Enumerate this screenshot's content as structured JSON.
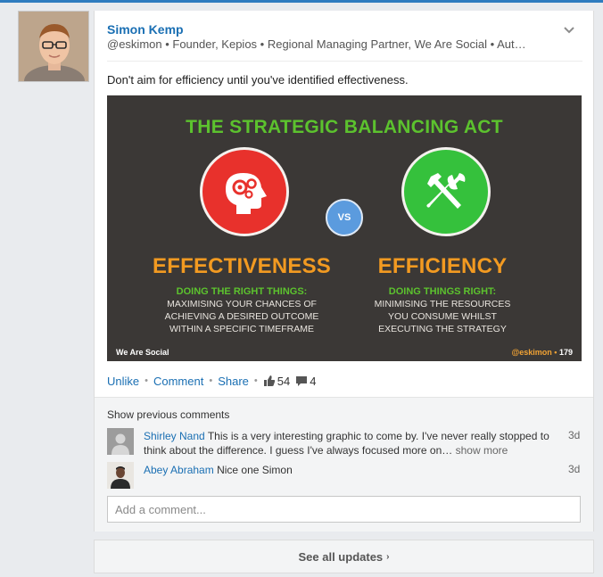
{
  "post": {
    "author_name": "Simon Kemp",
    "author_headline": "@eskimon • Founder, Kepios • Regional Managing Partner, We Are Social • Aut…",
    "text": "Don't aim for efficiency until you've identified effectiveness."
  },
  "slide": {
    "title": "THE STRATEGIC BALANCING ACT",
    "vs": "VS",
    "left_word": "EFFECTIVENESS",
    "left_sub": "DOING THE RIGHT THINGS:",
    "left_lines": [
      "MAXIMISING YOUR CHANCES OF",
      "ACHIEVING A DESIRED OUTCOME",
      "WITHIN A SPECIFIC TIMEFRAME"
    ],
    "right_word": "EFFICIENCY",
    "right_sub": "DOING THINGS RIGHT:",
    "right_lines": [
      "MINIMISING THE RESOURCES",
      "YOU CONSUME WHILST",
      "EXECUTING THE STRATEGY"
    ],
    "brand": "We Are Social",
    "handle": "@eskimon",
    "dot": "•",
    "page_number": "179",
    "colors": {
      "title_green": "#5cc22e",
      "orange": "#f29a21",
      "red_circle": "#e8312c",
      "green_circle": "#35c13c",
      "vs_blue": "#5b9bde"
    }
  },
  "actions": {
    "unlike": "Unlike",
    "comment": "Comment",
    "share": "Share",
    "separator": "•",
    "likes": "54",
    "comments": "4"
  },
  "comments": {
    "show_previous": "Show previous comments",
    "items": [
      {
        "author": "Shirley Nand",
        "line1": "This is a very interesting graphic to come by. I've never really stopped to",
        "line2": "think about the difference. I guess I've always focused more on…",
        "more": "show more",
        "time": "3d"
      },
      {
        "author": "Abey Abraham",
        "line1": "Nice one Simon",
        "time": "3d"
      }
    ],
    "input_placeholder": "Add a comment..."
  },
  "footer": {
    "see_all": "See all updates",
    "caret": "›"
  },
  "icons": {
    "menu": "chevron-down-icon",
    "like": "thumbs-up-icon",
    "comment_count": "speech-bubble-icon"
  }
}
